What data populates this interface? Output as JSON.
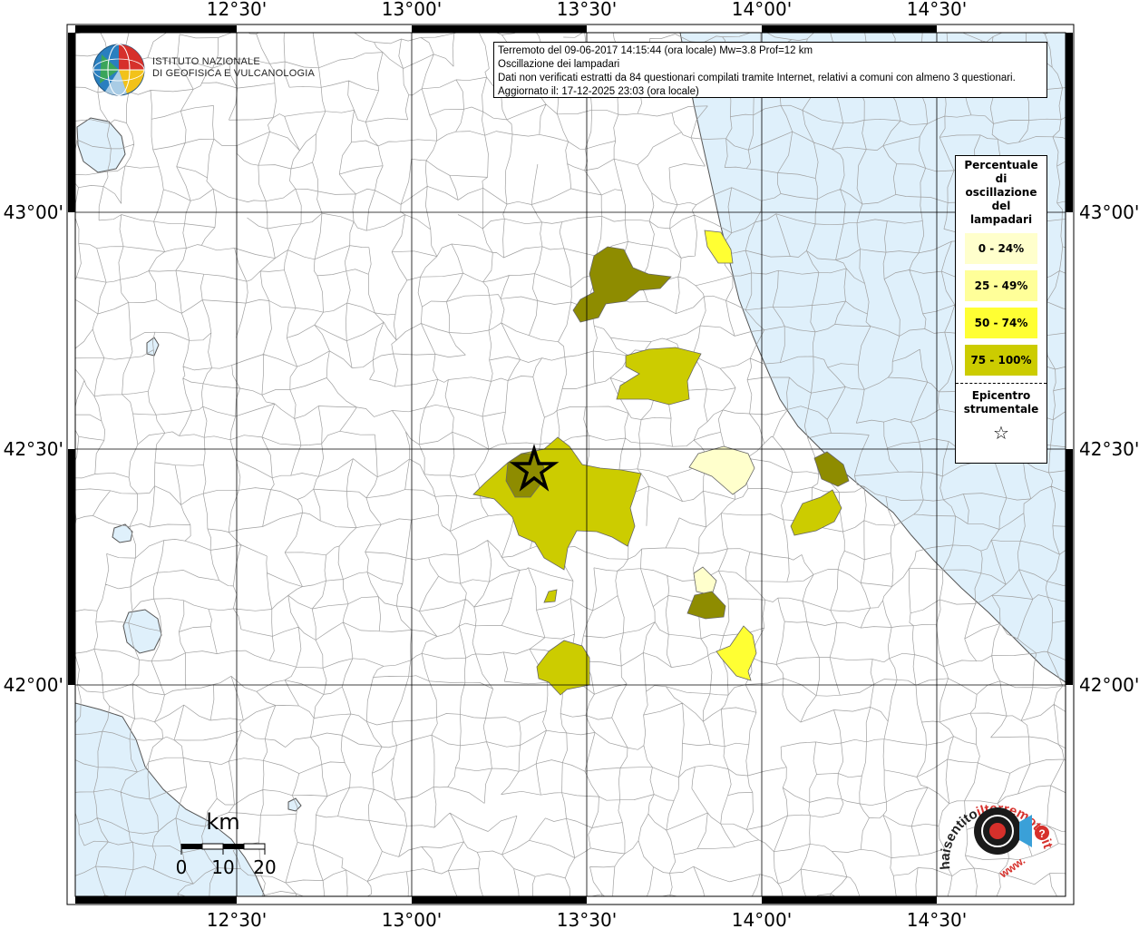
{
  "map": {
    "ticks_top_bottom": [
      "12°30'",
      "13°00'",
      "13°30'",
      "14°00'",
      "14°30'"
    ],
    "ticks_left_right": [
      "43°00'",
      "42°30'",
      "42°00'"
    ]
  },
  "logo": {
    "line1": "ISTITUTO NAZIONALE",
    "line2": "DI GEOFISICA E VULCANOLOGIA"
  },
  "info": {
    "line1": "Terremoto del 09-06-2017 14:15:44 (ora locale) Mw=3.8 Prof=12 km",
    "line2": "Oscillazione dei lampadari",
    "line3": "Dati non verificati estratti da 84 questionari compilati tramite Internet, relativi a comuni con almeno 3 questionari.",
    "line4": "Aggiornato il: 17-12-2025 23:03 (ora locale)"
  },
  "legend": {
    "title_lines": [
      "Percentuale",
      "di",
      "oscillazione",
      "del",
      "lampadari"
    ],
    "items": [
      {
        "label": "0 - 24%",
        "color": "#ffffcc"
      },
      {
        "label": "25 - 49%",
        "color": "#ffff99"
      },
      {
        "label": "50 - 74%",
        "color": "#ffff33"
      },
      {
        "label": "75 - 100%",
        "color": "#cccc00"
      }
    ],
    "epicentre_lines": [
      "Epicentro",
      "strumentale"
    ],
    "epicentre_symbol": "☆"
  },
  "scale": {
    "unit": "km",
    "labels": [
      "0",
      "10",
      "20"
    ]
  },
  "brand": {
    "text1": "haisentito",
    "text2": "ilterremoto.it",
    "text3": "www."
  },
  "colors": {
    "sea": "#dff0fb",
    "c0_24": "#ffffcc",
    "c25_49": "#ffff99",
    "c50_74": "#ffff33",
    "c75_100": "#cccc00",
    "dark": "#8e8c00",
    "muni_border": "#9a9a9a"
  }
}
